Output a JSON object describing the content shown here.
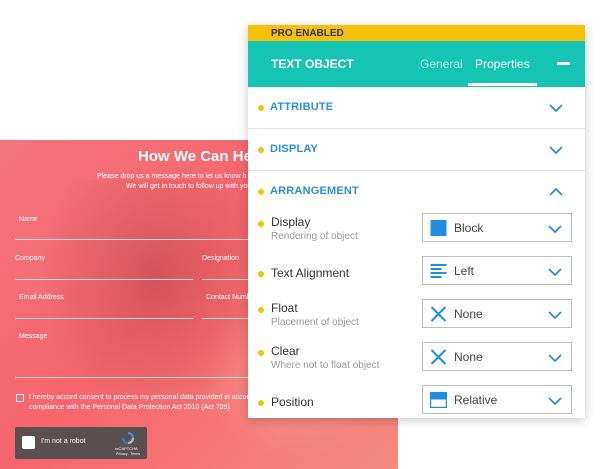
{
  "form": {
    "title": "How We Can Hel",
    "subtitle_line1": "Please drop us a message here to let us know h",
    "subtitle_line2": "We will get in touch to follow up with you",
    "fields": {
      "name": "Name",
      "company": "Company",
      "designation": "Designation",
      "email": "Email Address",
      "contact": "Contact Numb",
      "message": "Message"
    },
    "consent_line1": "I hereby accord consent to process my personal data provided in accor",
    "consent_line2": "compliance with the Personal Data Protection Act 2010 (Act 709).",
    "recaptcha": {
      "label": "I'm not a robot",
      "brand": "reCAPTCHA",
      "privacy": "Privacy - Terms"
    }
  },
  "panel": {
    "badge": "PRO ENABLED",
    "title": "TEXT OBJECT",
    "tabs": [
      {
        "label": "General",
        "active": false
      },
      {
        "label": "Properties",
        "active": true
      }
    ],
    "sections": [
      {
        "title": "ATTRIBUTE",
        "expanded": false
      },
      {
        "title": "DISPLAY",
        "expanded": false
      },
      {
        "title": "ARRANGEMENT",
        "expanded": true
      }
    ],
    "properties": [
      {
        "label": "Display",
        "description": "Rendering of object",
        "value": "Block",
        "icon": "block-square-icon"
      },
      {
        "label": "Text Alignment",
        "description": "",
        "value": "Left",
        "icon": "align-left-icon"
      },
      {
        "label": "Float",
        "description": "Placement of object",
        "value": "None",
        "icon": "x-icon"
      },
      {
        "label": "Clear",
        "description": "Where not to float object",
        "value": "None",
        "icon": "x-icon"
      },
      {
        "label": "Position",
        "description": "",
        "value": "Relative",
        "icon": "position-relative-icon"
      }
    ]
  },
  "colors": {
    "accent_teal": "#16c4b3",
    "pro_yellow": "#f6c10a",
    "section_blue": "#2b8fd8",
    "dot_yellow": "#f3c300",
    "icon_blue": "#1e8fe0",
    "form_red": "#f6656d"
  }
}
